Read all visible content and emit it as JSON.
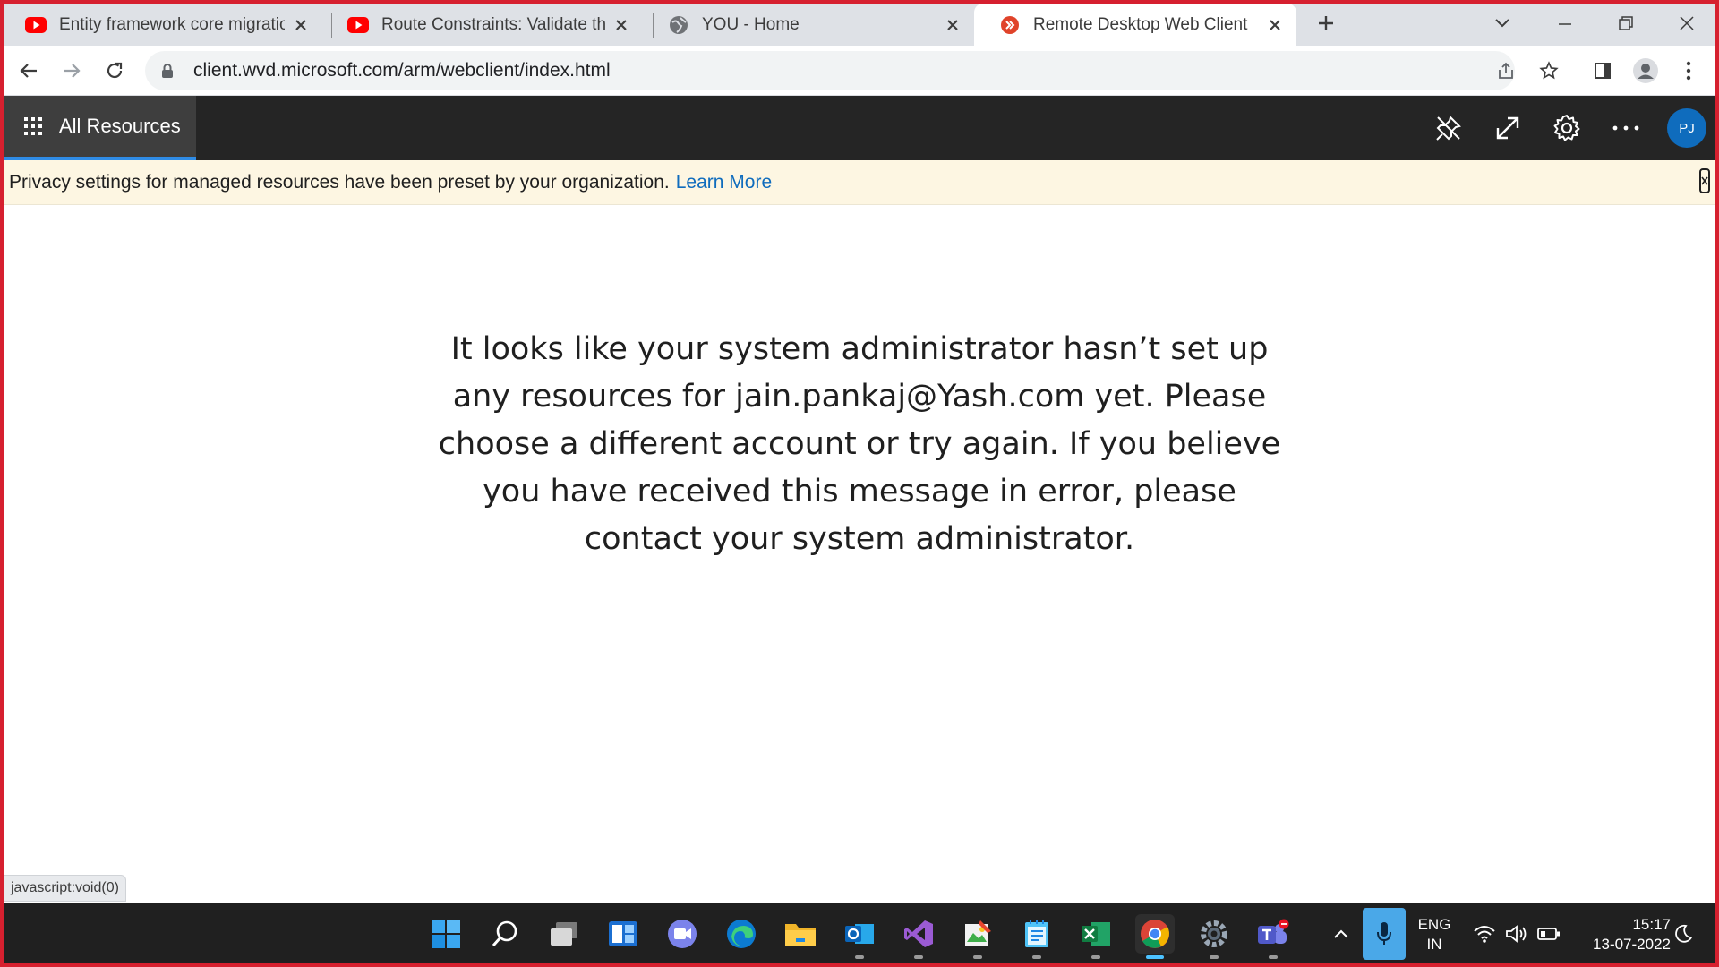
{
  "browser": {
    "tabs": [
      {
        "title": "Entity framework core migrations",
        "favicon": "youtube-icon"
      },
      {
        "title": "Route Constraints: Validate the route",
        "favicon": "youtube-icon"
      },
      {
        "title": "YOU - Home",
        "favicon": "globe-icon"
      },
      {
        "title": "Remote Desktop Web Client",
        "favicon": "remote-desktop-icon"
      }
    ],
    "active_tab_index": 3,
    "url": "client.wvd.microsoft.com/arm/webclient/index.html"
  },
  "app": {
    "nav_label": "All Resources",
    "avatar_initials": "PJ",
    "banner_text": "Privacy settings for managed resources have been preset by your organization.",
    "banner_link": "Learn More",
    "message_lines": [
      "It looks like your system administrator hasn’t set up",
      "any resources for jain.pankaj@Yash.com yet. Please",
      "choose a different account or try again. If you believe",
      "you have received this message in error, please",
      "contact your system administrator."
    ]
  },
  "status_text": "javascript:void(0)",
  "taskbar": {
    "lang_primary": "ENG",
    "lang_secondary": "IN",
    "time": "15:17",
    "date": "13-07-2022"
  },
  "colors": {
    "accent": "#2f8ce6",
    "header_bg": "#252525",
    "banner_bg": "#fdf6e2",
    "link": "#0f6cbd",
    "frame": "#d6202f"
  }
}
